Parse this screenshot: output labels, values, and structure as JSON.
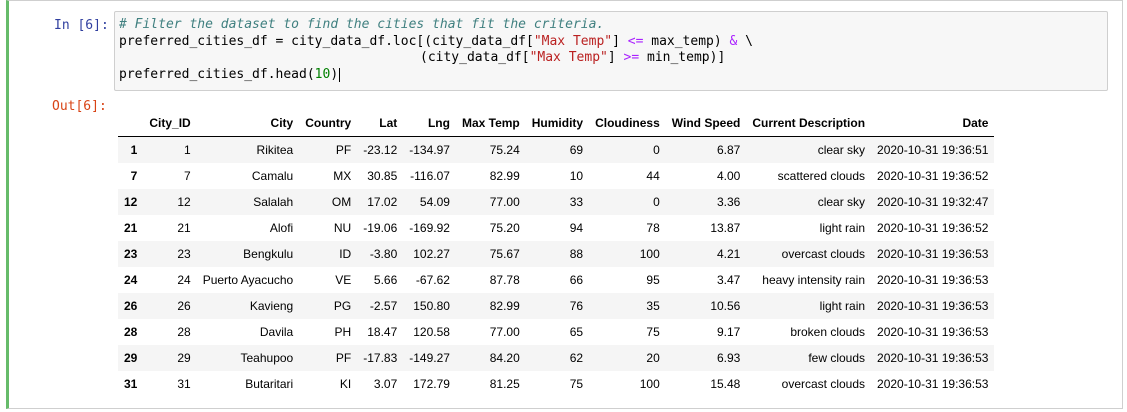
{
  "cell": {
    "in_prompt": "In [6]:",
    "out_prompt": "Out[6]:",
    "code": {
      "comment": "# Filter the dataset to find the cities that fit the criteria.",
      "line2_prefix": "preferred_cities_df = city_data_df.loc[(city_data_df[",
      "max_temp_key": "\"Max Temp\"",
      "line2_mid": "] ",
      "op_le": "<=",
      "line2_suffix": " max_temp) ",
      "op_amp": "&",
      "line2_end": " \\",
      "line3_prefix": "(city_data_df[",
      "line3_mid": "] ",
      "op_ge": ">=",
      "line3_suffix": " min_temp)]",
      "line4_prefix": "preferred_cities_df.head(",
      "line4_num": "10",
      "line4_suffix": ")"
    }
  },
  "table": {
    "columns": [
      "",
      "City_ID",
      "City",
      "Country",
      "Lat",
      "Lng",
      "Max Temp",
      "Humidity",
      "Cloudiness",
      "Wind Speed",
      "Current Description",
      "Date"
    ],
    "rows": [
      [
        "1",
        "1",
        "Rikitea",
        "PF",
        "-23.12",
        "-134.97",
        "75.24",
        "69",
        "0",
        "6.87",
        "clear sky",
        "2020-10-31 19:36:51"
      ],
      [
        "7",
        "7",
        "Camalu",
        "MX",
        "30.85",
        "-116.07",
        "82.99",
        "10",
        "44",
        "4.00",
        "scattered clouds",
        "2020-10-31 19:36:52"
      ],
      [
        "12",
        "12",
        "Salalah",
        "OM",
        "17.02",
        "54.09",
        "77.00",
        "33",
        "0",
        "3.36",
        "clear sky",
        "2020-10-31 19:32:47"
      ],
      [
        "21",
        "21",
        "Alofi",
        "NU",
        "-19.06",
        "-169.92",
        "75.20",
        "94",
        "78",
        "13.87",
        "light rain",
        "2020-10-31 19:36:52"
      ],
      [
        "23",
        "23",
        "Bengkulu",
        "ID",
        "-3.80",
        "102.27",
        "75.67",
        "88",
        "100",
        "4.21",
        "overcast clouds",
        "2020-10-31 19:36:53"
      ],
      [
        "24",
        "24",
        "Puerto Ayacucho",
        "VE",
        "5.66",
        "-67.62",
        "87.78",
        "66",
        "95",
        "3.47",
        "heavy intensity rain",
        "2020-10-31 19:36:53"
      ],
      [
        "26",
        "26",
        "Kavieng",
        "PG",
        "-2.57",
        "150.80",
        "82.99",
        "76",
        "35",
        "10.56",
        "light rain",
        "2020-10-31 19:36:53"
      ],
      [
        "28",
        "28",
        "Davila",
        "PH",
        "18.47",
        "120.58",
        "77.00",
        "65",
        "75",
        "9.17",
        "broken clouds",
        "2020-10-31 19:36:53"
      ],
      [
        "29",
        "29",
        "Teahupoo",
        "PF",
        "-17.83",
        "-149.27",
        "84.20",
        "62",
        "20",
        "6.93",
        "few clouds",
        "2020-10-31 19:36:53"
      ],
      [
        "31",
        "31",
        "Butaritari",
        "KI",
        "3.07",
        "172.79",
        "81.25",
        "75",
        "100",
        "15.48",
        "overcast clouds",
        "2020-10-31 19:36:53"
      ]
    ]
  }
}
